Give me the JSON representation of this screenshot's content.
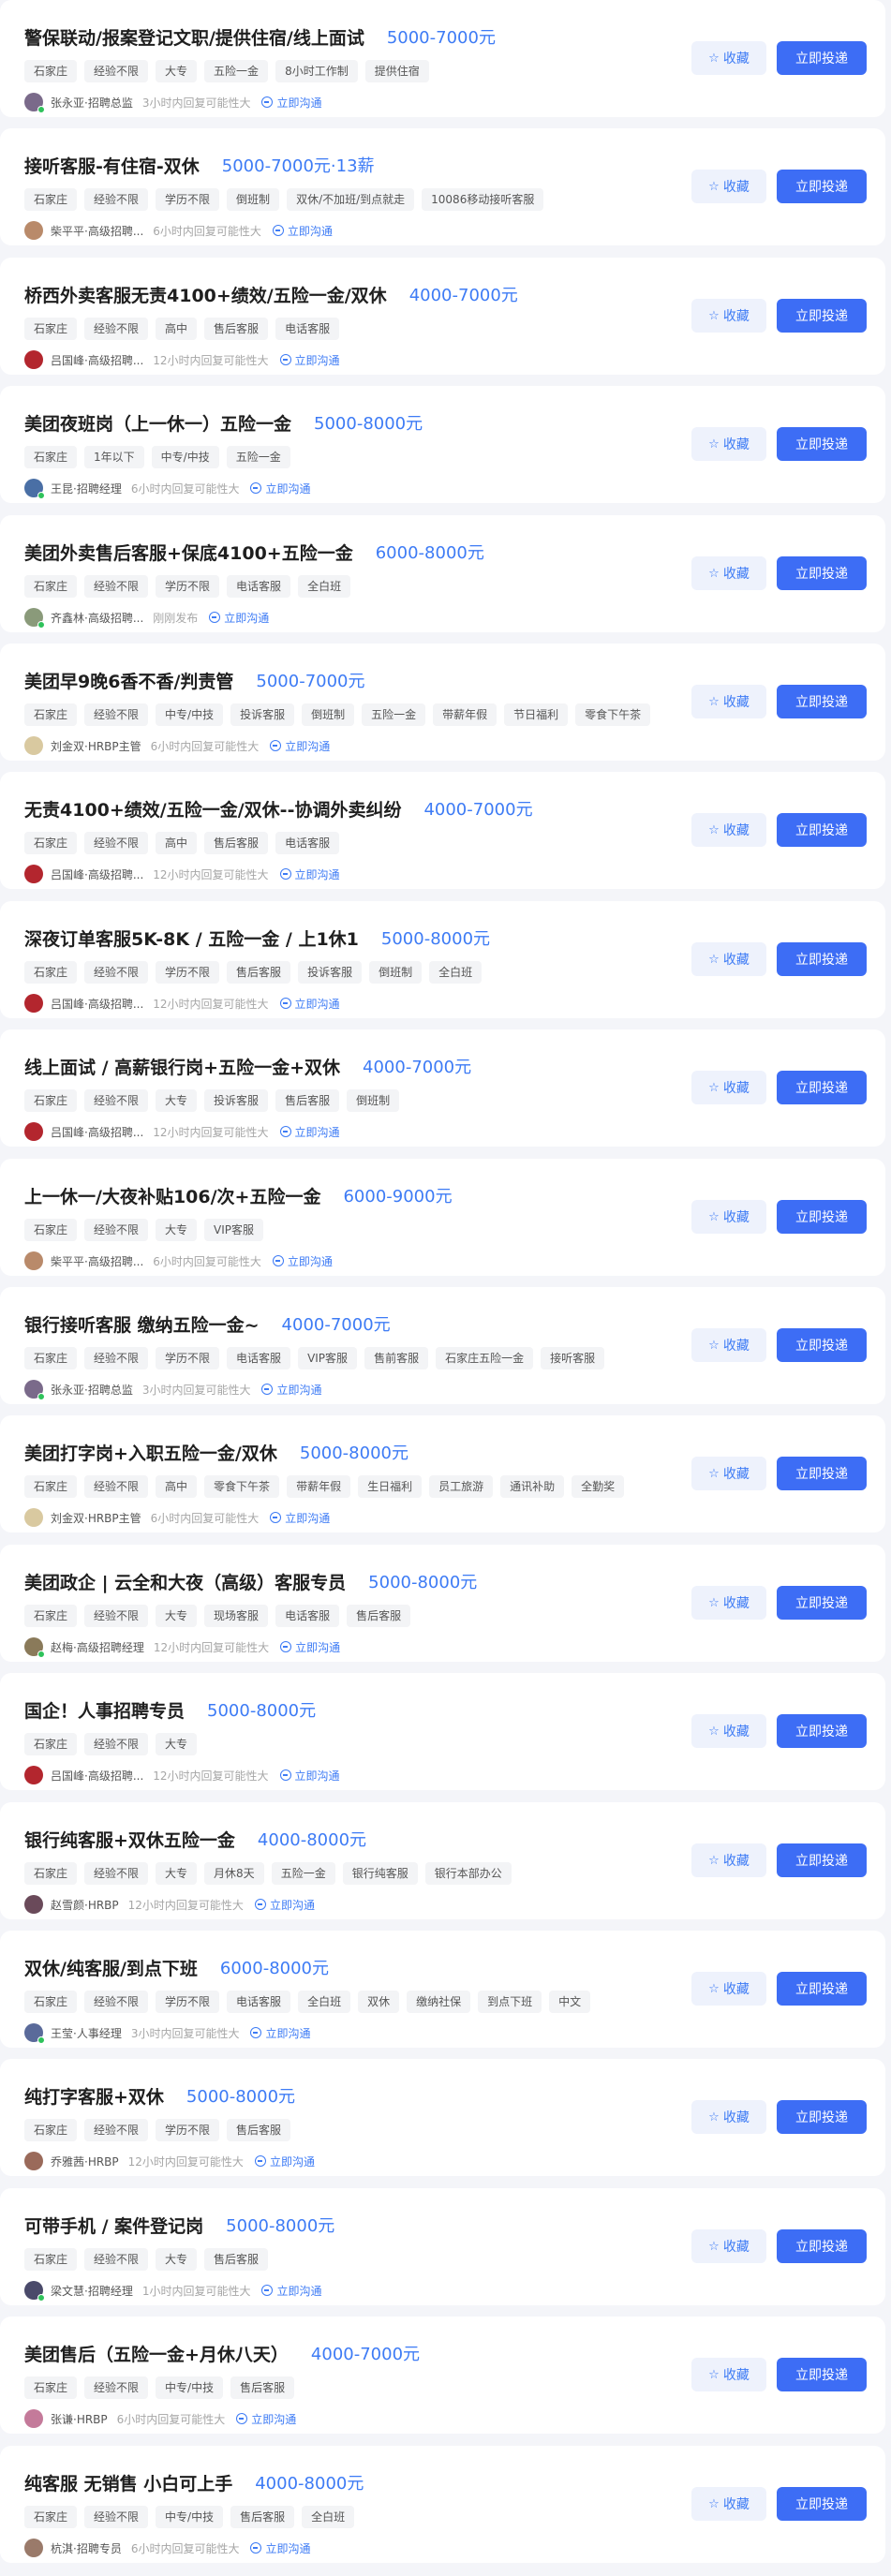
{
  "buttons": {
    "favorite_label": "收藏",
    "apply_label": "立即投递",
    "chat_label": "立即沟通"
  },
  "colors": {
    "salary": "#3d7bf5",
    "apply_button": "#3d6df5",
    "favorite_button_bg": "#eef2fc",
    "online": "#2fc25b"
  },
  "jobs": [
    {
      "title": "警保联动/报案登记文职/提供住宿/线上面试",
      "salary": "5000-7000元",
      "tags": [
        "石家庄",
        "经验不限",
        "大专",
        "五险一金",
        "8小时工作制",
        "提供住宿"
      ],
      "recruiter": "张永亚·招聘总监",
      "response": "3小时内回复可能性大",
      "avatar_color": "#7a6a8a",
      "online": true
    },
    {
      "title": "接听客服-有住宿-双休",
      "salary": "5000-7000元·13薪",
      "tags": [
        "石家庄",
        "经验不限",
        "学历不限",
        "倒班制",
        "双休/不加班/到点就走",
        "10086移动接听客服"
      ],
      "recruiter": "柴平平·高级招聘...",
      "response": "6小时内回复可能性大",
      "avatar_color": "#b98a6a",
      "online": false
    },
    {
      "title": "桥西外卖客服无责4100+绩效/五险一金/双休",
      "salary": "4000-7000元",
      "tags": [
        "石家庄",
        "经验不限",
        "高中",
        "售后客服",
        "电话客服"
      ],
      "recruiter": "吕国峰·高级招聘...",
      "response": "12小时内回复可能性大",
      "avatar_color": "#b3262e",
      "online": false
    },
    {
      "title": "美团夜班岗（上一休一）五险一金",
      "salary": "5000-8000元",
      "tags": [
        "石家庄",
        "1年以下",
        "中专/中技",
        "五险一金"
      ],
      "recruiter": "王昆·招聘经理",
      "response": "6小时内回复可能性大",
      "avatar_color": "#4a6fa5",
      "online": true
    },
    {
      "title": "美团外卖售后客服+保底4100+五险一金",
      "salary": "6000-8000元",
      "tags": [
        "石家庄",
        "经验不限",
        "学历不限",
        "电话客服",
        "全白班"
      ],
      "recruiter": "齐鑫林·高级招聘...",
      "response": "刚刚发布",
      "avatar_color": "#8a9a7a",
      "online": true
    },
    {
      "title": "美团早9晚6香不香/判责管",
      "salary": "5000-7000元",
      "tags": [
        "石家庄",
        "经验不限",
        "中专/中技",
        "投诉客服",
        "倒班制",
        "五险一金",
        "带薪年假",
        "节日福利",
        "零食下午茶"
      ],
      "recruiter": "刘金双·HRBP主管",
      "response": "6小时内回复可能性大",
      "avatar_color": "#d9c9a0",
      "online": false
    },
    {
      "title": "无责4100+绩效/五险一金/双休--协调外卖纠纷",
      "salary": "4000-7000元",
      "tags": [
        "石家庄",
        "经验不限",
        "高中",
        "售后客服",
        "电话客服"
      ],
      "recruiter": "吕国峰·高级招聘...",
      "response": "12小时内回复可能性大",
      "avatar_color": "#b3262e",
      "online": false
    },
    {
      "title": "深夜订单客服5K-8K / 五险一金 / 上1休1",
      "salary": "5000-8000元",
      "tags": [
        "石家庄",
        "经验不限",
        "学历不限",
        "售后客服",
        "投诉客服",
        "倒班制",
        "全白班"
      ],
      "recruiter": "吕国峰·高级招聘...",
      "response": "12小时内回复可能性大",
      "avatar_color": "#b3262e",
      "online": false
    },
    {
      "title": "线上面试 / 高薪银行岗+五险一金+双休",
      "salary": "4000-7000元",
      "tags": [
        "石家庄",
        "经验不限",
        "大专",
        "投诉客服",
        "售后客服",
        "倒班制"
      ],
      "recruiter": "吕国峰·高级招聘...",
      "response": "12小时内回复可能性大",
      "avatar_color": "#b3262e",
      "online": false
    },
    {
      "title": "上一休一/大夜补贴106/次+五险一金",
      "salary": "6000-9000元",
      "tags": [
        "石家庄",
        "经验不限",
        "大专",
        "VIP客服"
      ],
      "recruiter": "柴平平·高级招聘...",
      "response": "6小时内回复可能性大",
      "avatar_color": "#b98a6a",
      "online": false
    },
    {
      "title": "银行接听客服 缴纳五险一金~",
      "salary": "4000-7000元",
      "tags": [
        "石家庄",
        "经验不限",
        "学历不限",
        "电话客服",
        "VIP客服",
        "售前客服",
        "石家庄五险一金",
        "接听客服"
      ],
      "recruiter": "张永亚·招聘总监",
      "response": "3小时内回复可能性大",
      "avatar_color": "#7a6a8a",
      "online": true
    },
    {
      "title": "美团打字岗+入职五险一金/双休",
      "salary": "5000-8000元",
      "tags": [
        "石家庄",
        "经验不限",
        "高中",
        "零食下午茶",
        "带薪年假",
        "生日福利",
        "员工旅游",
        "通讯补助",
        "全勤奖"
      ],
      "recruiter": "刘金双·HRBP主管",
      "response": "6小时内回复可能性大",
      "avatar_color": "#d9c9a0",
      "online": false
    },
    {
      "title": "美团政企 | 云全和大夜（高级）客服专员",
      "salary": "5000-8000元",
      "tags": [
        "石家庄",
        "经验不限",
        "大专",
        "现场客服",
        "电话客服",
        "售后客服"
      ],
      "recruiter": "赵梅·高级招聘经理",
      "response": "12小时内回复可能性大",
      "avatar_color": "#8a7a5a",
      "online": true
    },
    {
      "title": "国企！人事招聘专员",
      "salary": "5000-8000元",
      "tags": [
        "石家庄",
        "经验不限",
        "大专"
      ],
      "recruiter": "吕国峰·高级招聘...",
      "response": "12小时内回复可能性大",
      "avatar_color": "#b3262e",
      "online": false
    },
    {
      "title": "银行纯客服+双休五险一金",
      "salary": "4000-8000元",
      "tags": [
        "石家庄",
        "经验不限",
        "大专",
        "月休8天",
        "五险一金",
        "银行纯客服",
        "银行本部办公"
      ],
      "recruiter": "赵雪颜·HRBP",
      "response": "12小时内回复可能性大",
      "avatar_color": "#6a4a5a",
      "online": false
    },
    {
      "title": "双休/纯客服/到点下班",
      "salary": "6000-8000元",
      "tags": [
        "石家庄",
        "经验不限",
        "学历不限",
        "电话客服",
        "全白班",
        "双休",
        "缴纳社保",
        "到点下班",
        "中文"
      ],
      "recruiter": "王莹·人事经理",
      "response": "3小时内回复可能性大",
      "avatar_color": "#5a6a9a",
      "online": true
    },
    {
      "title": "纯打字客服+双休",
      "salary": "5000-8000元",
      "tags": [
        "石家庄",
        "经验不限",
        "学历不限",
        "售后客服"
      ],
      "recruiter": "乔雅茜·HRBP",
      "response": "12小时内回复可能性大",
      "avatar_color": "#9a6a5a",
      "online": false
    },
    {
      "title": "可带手机 / 案件登记岗",
      "salary": "5000-8000元",
      "tags": [
        "石家庄",
        "经验不限",
        "大专",
        "售后客服"
      ],
      "recruiter": "梁文慧·招聘经理",
      "response": "1小时内回复可能性大",
      "avatar_color": "#4a4a6a",
      "online": true
    },
    {
      "title": "美团售后（五险一金+月休八天）",
      "salary": "4000-7000元",
      "tags": [
        "石家庄",
        "经验不限",
        "中专/中技",
        "售后客服"
      ],
      "recruiter": "张谦·HRBP",
      "response": "6小时内回复可能性大",
      "avatar_color": "#c47a9a",
      "online": false
    },
    {
      "title": "纯客服 无销售 小白可上手",
      "salary": "4000-8000元",
      "tags": [
        "石家庄",
        "经验不限",
        "中专/中技",
        "售后客服",
        "全白班"
      ],
      "recruiter": "杭淇·招聘专员",
      "response": "6小时内回复可能性大",
      "avatar_color": "#9a7a6a",
      "online": false
    }
  ]
}
